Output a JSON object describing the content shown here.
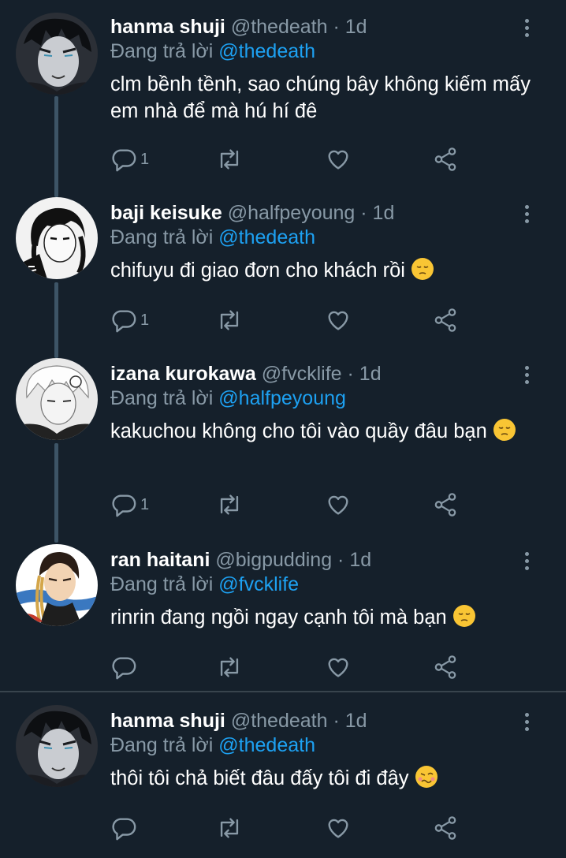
{
  "tweets": [
    {
      "name": "hanma shuji",
      "handle": "@thedeath",
      "dot": "·",
      "time": "1d",
      "reply_prefix": "Đang trả lời",
      "reply_to": "@thedeath",
      "text": "clm bềnh tềnh, sao chúng bây không kiếm mấy em nhà để mà hú hí đê",
      "emoji": "",
      "reply_count": "1",
      "avatar": "hanma-avatar"
    },
    {
      "name": "baji keisuke",
      "handle": "@halfpeyoung",
      "dot": "·",
      "time": "1d",
      "reply_prefix": "Đang trả lời",
      "reply_to": "@thedeath",
      "text": "chifuyu đi giao đơn cho khách rồi",
      "emoji": "pensive-face",
      "reply_count": "1",
      "avatar": "baji-avatar"
    },
    {
      "name": "izana kurokawa",
      "handle": "@fvcklife",
      "dot": "·",
      "time": "1d",
      "reply_prefix": "Đang trả lời",
      "reply_to": "@halfpeyoung",
      "text": "kakuchou không cho tôi vào quầy đâu bạn",
      "emoji": "pensive-face",
      "reply_count": "1",
      "avatar": "izana-avatar"
    },
    {
      "name": "ran haitani",
      "handle": "@bigpudding",
      "dot": "·",
      "time": "1d",
      "reply_prefix": "Đang trả lời",
      "reply_to": "@fvcklife",
      "text": "rinrin đang ngồi ngay cạnh tôi mà bạn",
      "emoji": "pensive-face",
      "reply_count": "",
      "avatar": "ran-avatar"
    },
    {
      "name": "hanma shuji",
      "handle": "@thedeath",
      "dot": "·",
      "time": "1d",
      "reply_prefix": "Đang trả lời",
      "reply_to": "@thedeath",
      "text": "thôi tôi chả biết đâu đấy tôi đi đây",
      "emoji": "woozy-face",
      "reply_count": "",
      "avatar": "hanma-avatar"
    }
  ],
  "colors": {
    "background": "#15202b",
    "secondary_text": "#8899a6",
    "link": "#1da1f2",
    "thread_line": "#3d5466"
  },
  "icons": [
    "reply-icon",
    "retweet-icon",
    "like-icon",
    "share-icon",
    "more-icon"
  ]
}
